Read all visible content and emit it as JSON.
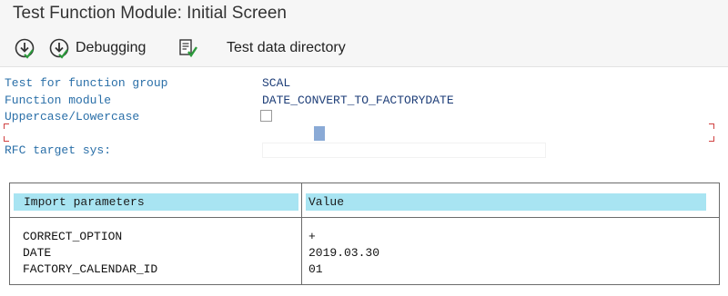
{
  "window": {
    "title": "Test Function Module: Initial Screen"
  },
  "toolbar": {
    "execute_icon": "execute-icon",
    "debugging_icon": "debug-execute-icon",
    "debugging_label": "Debugging",
    "test_data_icon": "test-data-directory-icon",
    "test_data_label": "Test data directory"
  },
  "form": {
    "group_label": "Test for function group",
    "group_value": "SCAL",
    "module_label": "Function module",
    "module_value": "DATE_CONVERT_TO_FACTORYDATE",
    "case_label": "Uppercase/Lowercase",
    "case_checked": false,
    "rfc_label": "RFC target sys:",
    "rfc_value": ""
  },
  "params_table": {
    "col_param": "Import parameters",
    "col_value": "Value",
    "rows": [
      {
        "name": "CORRECT_OPTION",
        "value": "+"
      },
      {
        "name": "DATE",
        "value": "2019.03.30"
      },
      {
        "name": "FACTORY_CALENDAR_ID",
        "value": "01"
      }
    ]
  },
  "colors": {
    "label_blue": "#2a6fa8",
    "value_navy": "#1e3e78",
    "header_cyan": "#a8e4f2",
    "bracket_red": "#d04040"
  }
}
